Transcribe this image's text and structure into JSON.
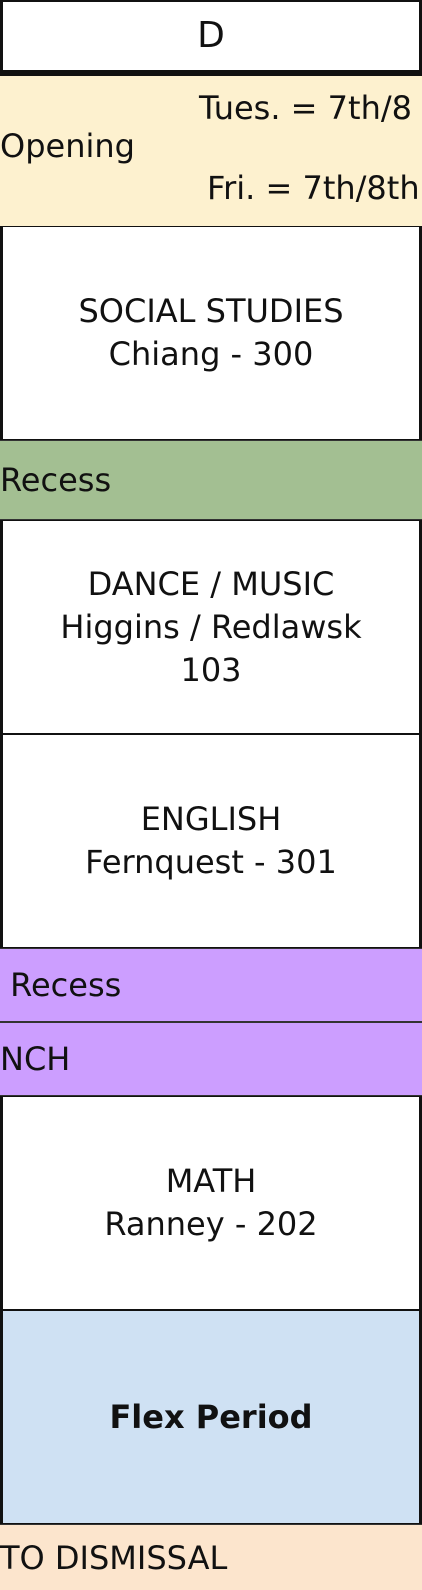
{
  "header": {
    "day": "D"
  },
  "opening": {
    "label": "Opening",
    "tue_line": "Tues. = 7th/8",
    "fri_line": "Fri. = 7th/8th"
  },
  "blocks": [
    {
      "subject": "SOCIAL STUDIES",
      "teacher": "Chiang - 300"
    },
    {
      "subject": "DANCE / MUSIC",
      "teacher": "Higgins / Redlawsk",
      "room": "103"
    },
    {
      "subject": "ENGLISH",
      "teacher": "Fernquest - 301"
    },
    {
      "subject": "MATH",
      "teacher": "Ranney - 202"
    }
  ],
  "bands": {
    "recess_1": "Recess",
    "recess_2": " Recess",
    "lunch": "NCH",
    "flex": "Flex Period",
    "dismissal": "TO DISMISSAL"
  },
  "colors": {
    "opening_bg": "#fdf1cf",
    "recess_green": "#a3bf92",
    "recess_purple": "#cc9eff",
    "flex_blue": "#cfe1f3",
    "dismissal_peach": "#fce5cd"
  }
}
